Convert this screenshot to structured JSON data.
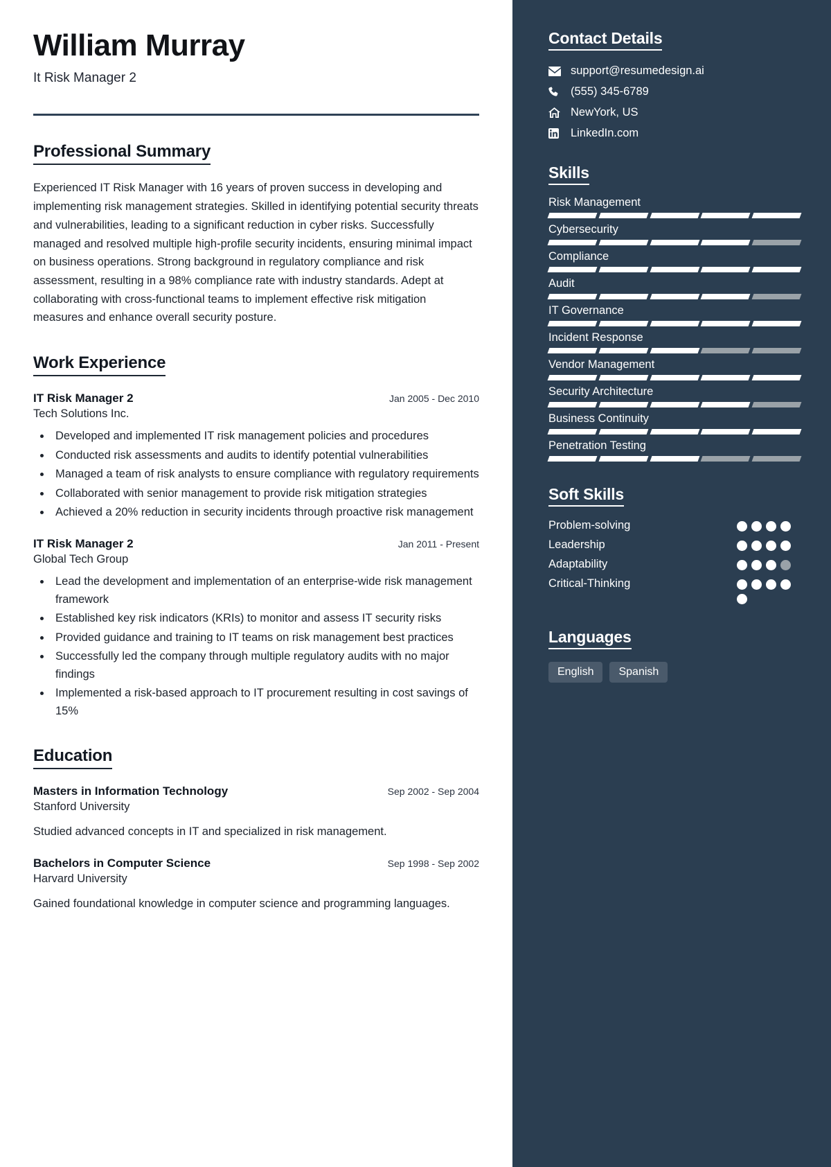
{
  "header": {
    "name": "William Murray",
    "job_title": "It Risk Manager 2"
  },
  "main": {
    "summary": {
      "heading": "Professional Summary",
      "text": "Experienced IT Risk Manager with 16 years of proven success in developing and implementing risk management strategies. Skilled in identifying potential security threats and vulnerabilities, leading to a significant reduction in cyber risks. Successfully managed and resolved multiple high-profile security incidents, ensuring minimal impact on business operations. Strong background in regulatory compliance and risk assessment, resulting in a 98% compliance rate with industry standards. Adept at collaborating with cross-functional teams to implement effective risk mitigation measures and enhance overall security posture."
    },
    "experience": {
      "heading": "Work Experience",
      "jobs": [
        {
          "role": "IT Risk Manager 2",
          "dates": "Jan 2005 - Dec 2010",
          "company": "Tech Solutions Inc.",
          "bullets": [
            "Developed and implemented IT risk management policies and procedures",
            "Conducted risk assessments and audits to identify potential vulnerabilities",
            "Managed a team of risk analysts to ensure compliance with regulatory requirements",
            "Collaborated with senior management to provide risk mitigation strategies",
            "Achieved a 20% reduction in security incidents through proactive risk management"
          ]
        },
        {
          "role": "IT Risk Manager 2",
          "dates": "Jan 2011 - Present",
          "company": "Global Tech Group",
          "bullets": [
            "Lead the development and implementation of an enterprise-wide risk management framework",
            "Established key risk indicators (KRIs) to monitor and assess IT security risks",
            "Provided guidance and training to IT teams on risk management best practices",
            "Successfully led the company through multiple regulatory audits with no major findings",
            "Implemented a risk-based approach to IT procurement resulting in cost savings of 15%"
          ]
        }
      ]
    },
    "education": {
      "heading": "Education",
      "items": [
        {
          "degree": "Masters in Information Technology",
          "dates": "Sep 2002 - Sep 2004",
          "school": "Stanford University",
          "description": "Studied advanced concepts in IT and specialized in risk management."
        },
        {
          "degree": "Bachelors in Computer Science",
          "dates": "Sep 1998 - Sep 2002",
          "school": "Harvard University",
          "description": "Gained foundational knowledge in computer science and programming languages."
        }
      ]
    }
  },
  "sidebar": {
    "contact": {
      "heading": "Contact Details",
      "items": [
        {
          "icon": "envelope-icon",
          "value": "support@resumedesign.ai"
        },
        {
          "icon": "phone-icon",
          "value": "(555) 345-6789"
        },
        {
          "icon": "home-icon",
          "value": "NewYork, US"
        },
        {
          "icon": "linkedin-icon",
          "value": "LinkedIn.com"
        }
      ]
    },
    "skills": {
      "heading": "Skills",
      "max": 5,
      "items": [
        {
          "label": "Risk Management",
          "level": 5
        },
        {
          "label": "Cybersecurity",
          "level": 4
        },
        {
          "label": "Compliance",
          "level": 5
        },
        {
          "label": "Audit",
          "level": 4
        },
        {
          "label": "IT Governance",
          "level": 5
        },
        {
          "label": "Incident Response",
          "level": 3
        },
        {
          "label": "Vendor Management",
          "level": 5
        },
        {
          "label": "Security Architecture",
          "level": 4
        },
        {
          "label": "Business Continuity",
          "level": 5
        },
        {
          "label": "Penetration Testing",
          "level": 3
        }
      ]
    },
    "soft_skills": {
      "heading": "Soft Skills",
      "items": [
        {
          "label": "Problem-solving",
          "total": 4,
          "filled": 4
        },
        {
          "label": "Leadership",
          "total": 4,
          "filled": 4
        },
        {
          "label": "Adaptability",
          "total": 4,
          "filled": 3
        },
        {
          "label": "Critical-Thinking",
          "total": 5,
          "filled": 5
        }
      ]
    },
    "languages": {
      "heading": "Languages",
      "items": [
        "English",
        "Spanish"
      ]
    }
  },
  "colors": {
    "sidebar_bg": "#2b3e51",
    "accent_rule": "#2f4256",
    "dot_off": "#9aa2a8",
    "pill_bg": "#4a5a6b"
  }
}
